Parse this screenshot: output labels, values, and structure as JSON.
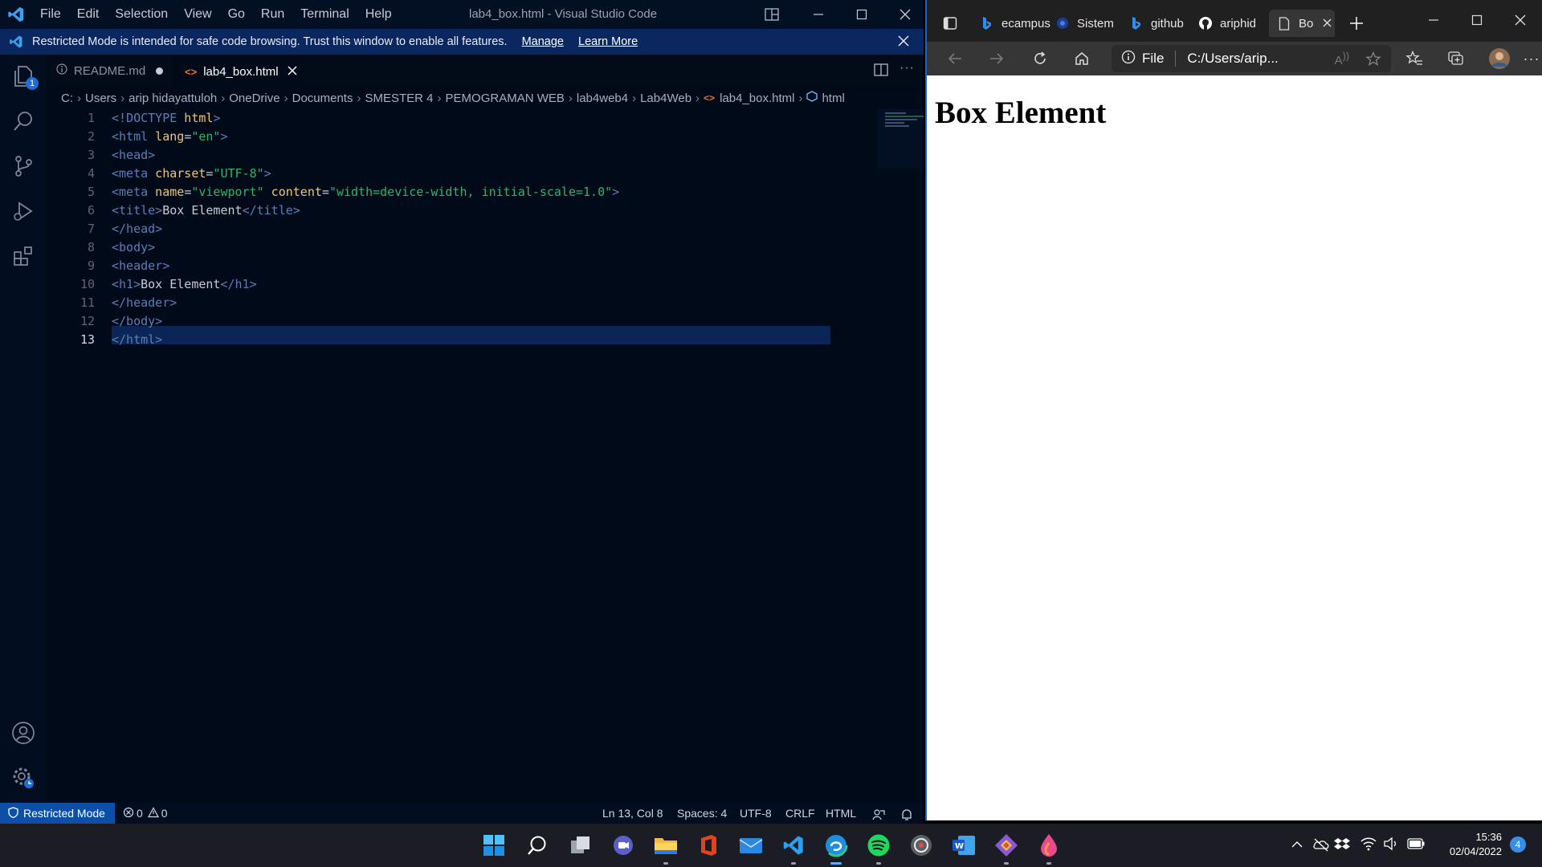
{
  "vscode": {
    "menu": [
      "File",
      "Edit",
      "Selection",
      "View",
      "Go",
      "Run",
      "Terminal",
      "Help"
    ],
    "window_title": "lab4_box.html - Visual Studio Code",
    "banner": {
      "text": "Restricted Mode is intended for safe code browsing. Trust this window to enable all features.",
      "manage": "Manage",
      "learn_more": "Learn More"
    },
    "activity_badge": "1",
    "tabs": [
      {
        "label": "README.md",
        "modified": true
      },
      {
        "label": "lab4_box.html",
        "active": true
      }
    ],
    "breadcrumb": [
      "C:",
      "Users",
      "arip hidayattuloh",
      "OneDrive",
      "Documents",
      "SMESTER 4",
      "PEMOGRAMAN WEB",
      "lab4web4",
      "Lab4Web",
      "lab4_box.html",
      "html"
    ],
    "line_numbers": [
      "1",
      "2",
      "3",
      "4",
      "5",
      "6",
      "7",
      "8",
      "9",
      "10",
      "11",
      "12",
      "13"
    ],
    "code": {
      "l1_a": "<!",
      "l1_b": "DOCTYPE",
      "l1_c": " html",
      "l1_d": ">",
      "l2_a": "<",
      "l2_b": "html",
      "l2_c": " lang",
      "l2_d": "=",
      "l2_e": "\"en\"",
      "l2_f": ">",
      "l3": "<head>",
      "l4_a": "<",
      "l4_b": "meta",
      "l4_c": " charset",
      "l4_d": "=",
      "l4_e": "\"UTF-8\"",
      "l4_f": ">",
      "l5_a": "<",
      "l5_b": "meta",
      "l5_c": " name",
      "l5_d": "=",
      "l5_e": "\"viewport\"",
      "l5_f": " content",
      "l5_g": "=",
      "l5_h": "\"width=device-width, initial-scale=1.0\"",
      "l5_i": ">",
      "l6_a": "<title>",
      "l6_b": "Box Element",
      "l6_c": "</title>",
      "l7": "</head>",
      "l8": "<body>",
      "l9": "<header>",
      "l10_a": "<h1>",
      "l10_b": "Box Element",
      "l10_c": "</h1>",
      "l11": "</header>",
      "l12": "</body>",
      "l13": "</html>"
    },
    "status": {
      "restricted": "Restricted Mode",
      "errors": "0",
      "warnings": "0",
      "position": "Ln 13, Col 8",
      "spaces": "Spaces: 4",
      "encoding": "UTF-8",
      "eol": "CRLF",
      "language": "HTML"
    }
  },
  "edge": {
    "tabs": [
      {
        "label": "ecampus"
      },
      {
        "label": "Sistem"
      },
      {
        "label": "github"
      },
      {
        "label": "ariphid"
      },
      {
        "label": "Bo",
        "active": true
      }
    ],
    "address_prefix": "File",
    "address": "C:/Users/arip...",
    "page_heading": "Box Element"
  },
  "taskbar": {
    "time": "15:36",
    "date": "02/04/2022",
    "notification_count": "4"
  },
  "colors": {
    "accent": "#0b4fa8",
    "editor_bg": "#010a19",
    "string": "#2fb56b",
    "tag": "#5a7fb8",
    "attribute": "#f0c674"
  }
}
